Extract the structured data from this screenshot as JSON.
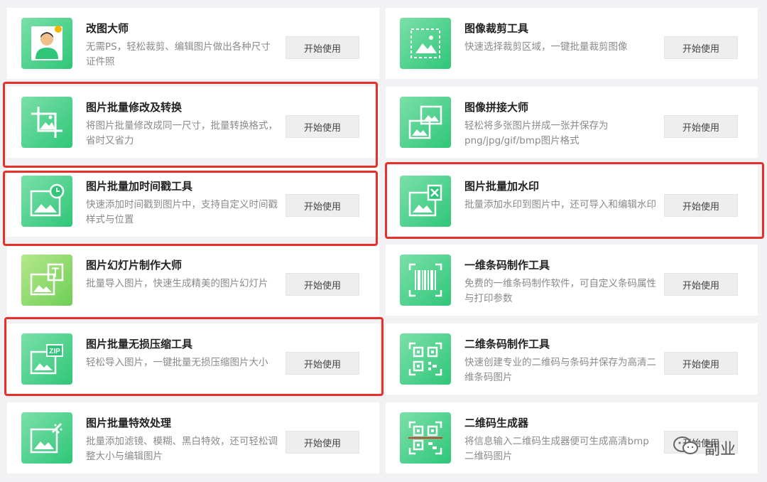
{
  "button_label": "开始使用",
  "watermark": {
    "text": "副业",
    "icon": "wechat-icon"
  },
  "cards": [
    {
      "title": "改图大师",
      "desc": "无需PS，轻松裁剪、编辑图片做出各种尺寸证件照",
      "icon": "id-photo-icon"
    },
    {
      "title": "图像裁剪工具",
      "desc": "快速选择裁剪区域，一键批量裁剪图像",
      "icon": "crop-frame-icon"
    },
    {
      "title": "图片批量修改及转换",
      "desc": "将图片批量修改成同一尺寸，批量转换格式，省时又省力",
      "icon": "crop-icon"
    },
    {
      "title": "图像拼接大师",
      "desc": "轻松将多张图片拼成一张并保存为png/jpg/gif/bmp图片格式",
      "icon": "stitch-icon"
    },
    {
      "title": "图片批量加时间戳工具",
      "desc": "快速添加时间戳到图片中，支持自定义时间戳样式与位置",
      "icon": "timestamp-icon"
    },
    {
      "title": "图片批量加水印",
      "desc": "批量添加水印到图片中，还可导入和编辑水印",
      "icon": "watermark-icon"
    },
    {
      "title": "图片幻灯片制作大师",
      "desc": "批量导入图片，快速生成精美的图片幻灯片",
      "icon": "slideshow-icon"
    },
    {
      "title": "一维条码制作工具",
      "desc": "免费的一维条码制作软件，可自定义条码属性与打印参数",
      "icon": "barcode-icon"
    },
    {
      "title": "图片批量无损压缩工具",
      "desc": "轻松导入图片，一键批量无损压缩图片大小",
      "icon": "zip-icon"
    },
    {
      "title": "二维条码制作工具",
      "desc": "快速创建专业的二维码与条码并保存为高清二维条码图片",
      "icon": "qrcode-icon"
    },
    {
      "title": "图片批量特效处理",
      "desc": "批量添加滤镜、模糊、黑白特效，还可轻松调整大小与编辑图片",
      "icon": "effects-icon"
    },
    {
      "title": "二维码生成器",
      "desc": "将信息输入二维码生成器便可生成高清bmp二维码图片",
      "icon": "qr-generator-icon"
    }
  ],
  "highlight_color": "#e8302a"
}
